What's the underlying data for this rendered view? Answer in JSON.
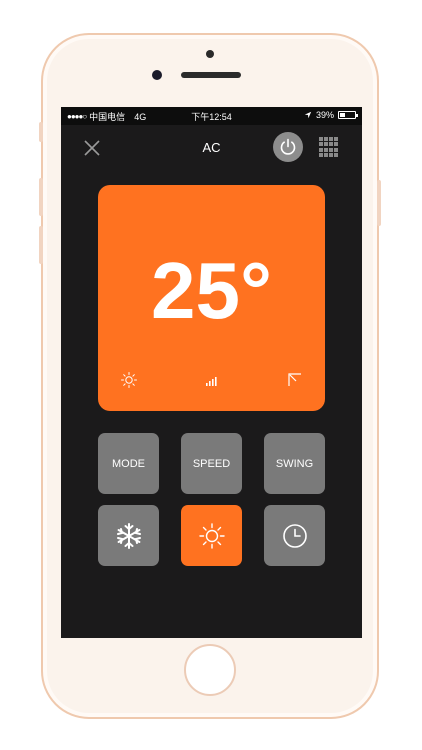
{
  "status_bar": {
    "signal_dots": "●●●●○",
    "carrier": "中国电信",
    "network": "4G",
    "time": "下午12:54",
    "location_icon": "location-arrow-icon",
    "battery_text": "39%",
    "battery_level": 0.39
  },
  "header": {
    "title": "AC",
    "close_icon": "close-icon",
    "power_icon": "power-icon",
    "menu_icon": "grid-icon"
  },
  "display": {
    "temperature": "25°",
    "mode_icon": "sun-icon",
    "speed_icon": "signal-bars-icon",
    "swing_icon": "swing-corner-icon",
    "accent_color": "#ff7220"
  },
  "controls": {
    "mode_label": "MODE",
    "speed_label": "SPEED",
    "swing_label": "SWING",
    "cool_icon": "snowflake-icon",
    "heat_icon": "sun-icon",
    "timer_icon": "clock-icon"
  }
}
